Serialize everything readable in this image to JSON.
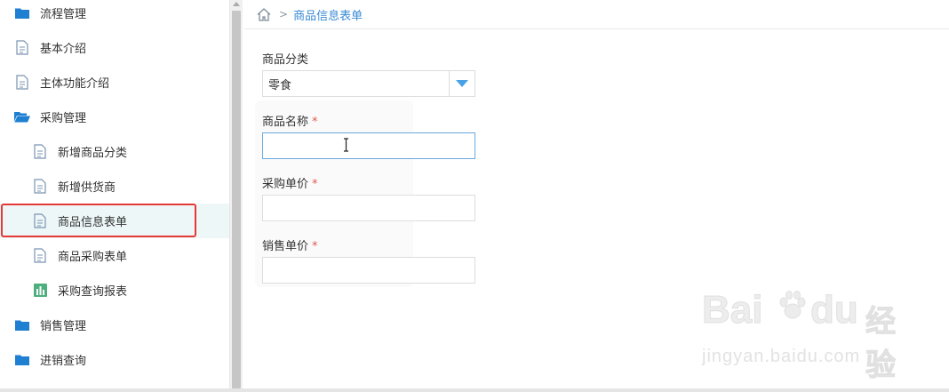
{
  "sidebar": {
    "items": [
      {
        "label": "流程管理",
        "icon": "folder-icon"
      },
      {
        "label": "基本介绍",
        "icon": "document-icon"
      },
      {
        "label": "主体功能介绍",
        "icon": "document-icon"
      },
      {
        "label": "采购管理",
        "icon": "folder-open-icon"
      },
      {
        "label": "新增商品分类",
        "icon": "document-icon"
      },
      {
        "label": "新增供货商",
        "icon": "document-icon"
      },
      {
        "label": "商品信息表单",
        "icon": "document-icon"
      },
      {
        "label": "商品采购表单",
        "icon": "document-icon"
      },
      {
        "label": "采购查询报表",
        "icon": "bar-chart-icon"
      },
      {
        "label": "销售管理",
        "icon": "folder-icon"
      },
      {
        "label": "进销查询",
        "icon": "folder-icon"
      }
    ],
    "active_index": 6
  },
  "breadcrumb": {
    "home_icon": "home-icon",
    "separator": ">",
    "current": "商品信息表单"
  },
  "form": {
    "category_label": "商品分类",
    "category_value": "零食",
    "name_label": "商品名称",
    "name_value": "",
    "purchase_price_label": "采购单价",
    "purchase_price_value": "",
    "sale_price_label": "销售单价",
    "sale_price_value": "",
    "required_mark": "*"
  },
  "watermark": {
    "brand": "Bai",
    "brand2": "du",
    "cn": "经验",
    "url": "jingyan.baidu.com"
  },
  "colors": {
    "accent": "#3a8ad6",
    "folder": "#1f7fd1",
    "highlight": "#e53935",
    "required": "#e05a4f",
    "active_bg": "#eef7f8"
  }
}
